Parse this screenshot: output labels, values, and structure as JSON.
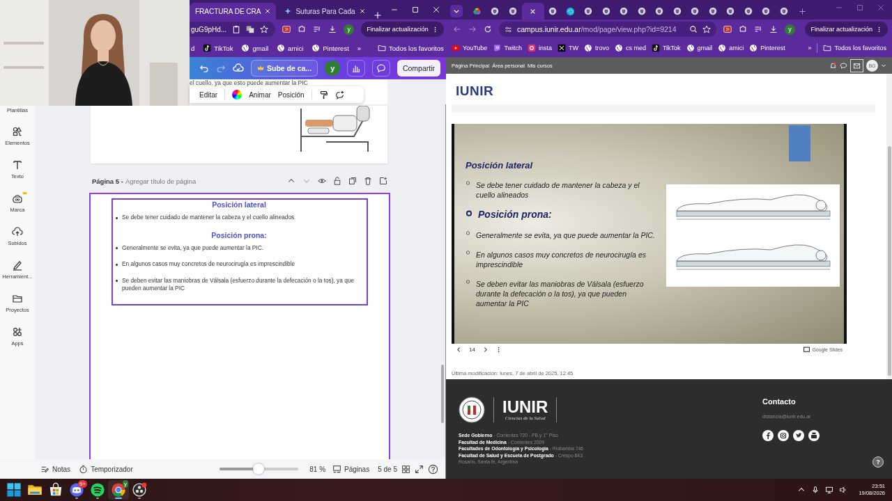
{
  "left_browser": {
    "tabs": [
      {
        "title": "FRACTURA DE CRA",
        "selected": true
      },
      {
        "title": "Suturas Para Cada",
        "selected": false
      }
    ],
    "address": "guG9pHd...",
    "profile": "y",
    "update_button": "Finalizar actualización",
    "bookmarks": [
      {
        "label": "d",
        "kind": "none"
      },
      {
        "label": "TikTok",
        "kind": "tiktok"
      },
      {
        "label": "gmail",
        "kind": "globe"
      },
      {
        "label": "amici",
        "kind": "globe"
      },
      {
        "label": "Pinterest",
        "kind": "globe"
      }
    ],
    "more_bookmarks": "»",
    "all_bookmarks": "Todos los favoritos"
  },
  "canva": {
    "upgrade_button": "Sube de ca...",
    "avatar": "y",
    "share_button": "Compartir",
    "cut_text": "el cuello. ya que esto puede aumentar la PIC",
    "toolbar": [
      "Editar",
      "Animar",
      "Posición"
    ],
    "sidebar": [
      {
        "label": "Plantillas",
        "premium": false
      },
      {
        "label": "Elementos",
        "premium": false
      },
      {
        "label": "Texto",
        "premium": false
      },
      {
        "label": "Marca",
        "premium": true
      },
      {
        "label": "Subidos",
        "premium": false
      },
      {
        "label": "Herramient...",
        "premium": false
      },
      {
        "label": "Proyectos",
        "premium": false
      },
      {
        "label": "Apps",
        "premium": false
      }
    ],
    "page": {
      "number": "Página 5 -",
      "title_placeholder": "Agregar título de página",
      "content": [
        {
          "kind": "heading",
          "text": "Posición lateral"
        },
        {
          "kind": "bullet",
          "text": "Se debe tener cuidado de mantener la cabeza y el cuello alineados"
        },
        {
          "kind": "heading",
          "text": "Posición prona:"
        },
        {
          "kind": "bullet",
          "text": "Generalmente se evita, ya que puede aumentar la PIC."
        },
        {
          "kind": "bullet",
          "text": "En algunos casos muy concretos de neurocirugía es imprescindible"
        },
        {
          "kind": "bullet",
          "text": "Se deben evitar las maniobras de Válsala (esfuerzo durante la defecación o la tos), ya que pueden aumentar la PIC"
        }
      ]
    },
    "bottom_bar": {
      "notes": "Notas",
      "timer": "Temporizador",
      "zoom": {
        "level": 0.49
      },
      "zoom_reading": "81 %",
      "pages": "Páginas",
      "page_count": "5 de 5"
    }
  },
  "right_browser": {
    "tabs": [
      {
        "kind": "drive",
        "selected": false
      },
      {
        "kind": "site",
        "selected": false
      },
      {
        "kind": "site",
        "selected": false
      },
      {
        "selected": true
      },
      {
        "kind": "site",
        "selected": false
      },
      {
        "kind": "edge",
        "selected": false
      },
      {
        "kind": "site",
        "selected": false
      },
      {
        "kind": "site",
        "selected": false
      },
      {
        "kind": "site",
        "selected": false
      },
      {
        "kind": "site",
        "selected": false
      },
      {
        "kind": "site",
        "selected": false
      },
      {
        "kind": "site",
        "selected": false
      },
      {
        "kind": "site",
        "selected": false
      },
      {
        "kind": "site",
        "selected": false
      },
      {
        "kind": "site",
        "selected": false
      },
      {
        "kind": "site",
        "selected": false
      },
      {
        "kind": "site",
        "selected": false
      },
      {
        "kind": "site",
        "selected": false
      }
    ],
    "address": {
      "domain": "campus.iunir.edu.ar",
      "path": "/mod/page/view.php?id=9214"
    },
    "profile": "y",
    "update_button": "Finalizar actualización",
    "bookmarks": [
      {
        "label": "YouTube",
        "kind": "youtube"
      },
      {
        "label": "Twitch",
        "kind": "twitch"
      },
      {
        "label": "insta",
        "kind": "instagram"
      },
      {
        "label": "TW",
        "kind": "x"
      },
      {
        "label": "trovo",
        "kind": "globe"
      },
      {
        "label": "cs med",
        "kind": "globe"
      },
      {
        "label": "TikTok",
        "kind": "tiktok"
      },
      {
        "label": "gmail",
        "kind": "globe"
      },
      {
        "label": "amici",
        "kind": "globe"
      },
      {
        "label": "Pinterest",
        "kind": "globe"
      }
    ],
    "more_bookmarks": "»",
    "all_bookmarks": "Todos los favoritos"
  },
  "moodle": {
    "nav": [
      "Página Principal",
      "Área personal",
      "Mis cursos"
    ],
    "user": "BG",
    "logo": "IUNIR",
    "slide": {
      "title": "Posición lateral",
      "items": [
        {
          "kind": "bullet",
          "text": "Se debe tener cuidado de mantener la cabeza y el cuello alineados"
        },
        {
          "kind": "heading",
          "text": "Posición prona:"
        },
        {
          "kind": "bullet",
          "text": "Generalmente se evita, ya que puede aumentar la PIC."
        },
        {
          "kind": "bullet",
          "text": "En algunos casos muy concretos de neurocirugía es imprescindible"
        },
        {
          "kind": "bullet",
          "text": "Se deben evitar las maniobras de Válsala (esfuerzo durante la defecación o la tos), ya que pueden aumentar la PIC"
        }
      ],
      "slide_number": "14",
      "provider": "Google Slides"
    },
    "last_modified": "Última modificación: lunes, 7 de abril de 2025, 12:45",
    "footer": {
      "logo": "IUNIR",
      "logo_subtitle": "Ciencias de la Salud",
      "addresses": [
        {
          "name": "Sede Gobierno",
          "detail": "- Corrientes 720 - PB y 1° Piso"
        },
        {
          "name": "Facultad de Medicina",
          "detail": "- Corrientes 2009"
        },
        {
          "name": "Facultades de Odontología y Psicología",
          "detail": "- Riobamba 746"
        },
        {
          "name": "Facultad de Salud y Escuela de Postgrado",
          "detail": "- Crespo 843"
        }
      ],
      "city": "Rosario, Santa fe, Argentina",
      "contact_title": "Contacto",
      "email": "distancia@iunir.edu.ar",
      "help": "?"
    }
  },
  "taskbar": {
    "apps": [
      {
        "kind": "windows",
        "running": false,
        "selected": false
      },
      {
        "kind": "explorer",
        "running": false,
        "selected": false
      },
      {
        "kind": "store",
        "running": false,
        "selected": false
      },
      {
        "kind": "discord",
        "badge": "9+",
        "running": true,
        "selected": false
      },
      {
        "kind": "spotify",
        "running": true,
        "selected": false
      },
      {
        "kind": "chrome",
        "badge": "y",
        "running": true,
        "selected": true
      },
      {
        "kind": "obs",
        "running": true,
        "selected": false
      }
    ],
    "time": "23:51",
    "date": "19/08/2026"
  }
}
